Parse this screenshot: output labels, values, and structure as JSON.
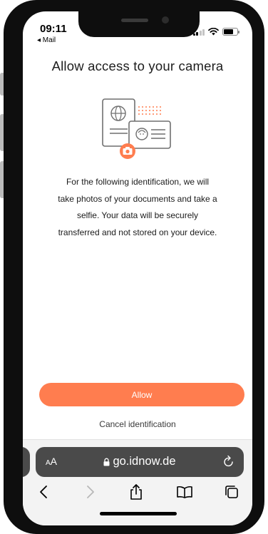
{
  "status_bar": {
    "time": "09:11",
    "back_label": "◂ Mail"
  },
  "page": {
    "title": "Allow access to your camera",
    "description_lines": [
      "For the following identification, we will",
      "take photos of your documents and take a",
      "selfie. Your data will be securely",
      "transferred and not stored on your device."
    ],
    "allow_button": "Allow",
    "cancel_link": "Cancel identification"
  },
  "browser": {
    "text_size_big": "A",
    "text_size_small": "A",
    "url": "go.idnow.de",
    "toolbar_icons": [
      "back-icon",
      "forward-icon",
      "share-icon",
      "bookmarks-icon",
      "tabs-icon"
    ]
  },
  "colors": {
    "accent": "#ff7d4f",
    "address_bar": "#4a4a4a",
    "illustration_line": "#6f6f6f"
  }
}
